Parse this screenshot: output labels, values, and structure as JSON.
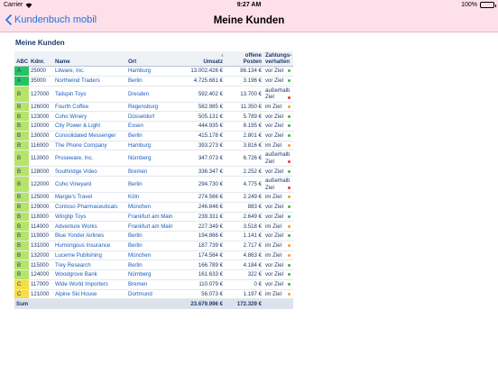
{
  "status_bar": {
    "carrier": "Carrier",
    "time": "9:27 AM",
    "battery": "100%",
    "battery_level": 1.0
  },
  "nav": {
    "back_label": "Kundenbuch mobil",
    "title": "Meine Kunden"
  },
  "section_title": "Meine Kunden",
  "colors": {
    "A": "#22c55e",
    "B": "#b6e36a",
    "C": "#f5dd45",
    "green": "#4caf50",
    "red": "#e53935",
    "orange": "#f0a030"
  },
  "columns": {
    "abc": "ABC",
    "kdnr": "Kdnr.",
    "name": "Name",
    "ort": "Ort",
    "umsatz": "Umsatz",
    "posten": "offene Posten",
    "verhalten": "Zahlungs- verhalten"
  },
  "rows": [
    {
      "abc": "A",
      "kdnr": "25000",
      "name": "Litware, Inc.",
      "ort": "Hamburg",
      "umsatz": "13.002.426 €",
      "posten": "86.134 €",
      "verhalten": "vor Ziel",
      "dot": "green"
    },
    {
      "abc": "A",
      "kdnr": "35000",
      "name": "Northwind Traders",
      "ort": "Berlin",
      "umsatz": "4.725.681 €",
      "posten": "3.196 €",
      "verhalten": "vor Ziel",
      "dot": "green"
    },
    {
      "abc": "B",
      "kdnr": "127000",
      "name": "Tailspin Toys",
      "ort": "Dresden",
      "umsatz": "592.402 €",
      "posten": "13.700 €",
      "verhalten": "außerhalb Ziel",
      "dot": "red"
    },
    {
      "abc": "B",
      "kdnr": "126000",
      "name": "Fourth Coffee",
      "ort": "Regensburg",
      "umsatz": "582.985 €",
      "posten": "11.350 €",
      "verhalten": "im Ziel",
      "dot": "orange"
    },
    {
      "abc": "B",
      "kdnr": "123000",
      "name": "Coho Winery",
      "ort": "Düsseldorf",
      "umsatz": "505.131 €",
      "posten": "5.789 €",
      "verhalten": "vor Ziel",
      "dot": "green"
    },
    {
      "abc": "B",
      "kdnr": "120000",
      "name": "City Power & Light",
      "ort": "Essen",
      "umsatz": "444.935 €",
      "posten": "8.195 €",
      "verhalten": "vor Ziel",
      "dot": "green"
    },
    {
      "abc": "B",
      "kdnr": "130000",
      "name": "Consolidated Messenger",
      "ort": "Berlin",
      "umsatz": "415.178 €",
      "posten": "2.801 €",
      "verhalten": "vor Ziel",
      "dot": "green"
    },
    {
      "abc": "B",
      "kdnr": "116000",
      "name": "The Phone Company",
      "ort": "Hamburg",
      "umsatz": "393.273 €",
      "posten": "3.816 €",
      "verhalten": "im Ziel",
      "dot": "orange"
    },
    {
      "abc": "B",
      "kdnr": "113000",
      "name": "Proseware, Inc.",
      "ort": "Nürnberg",
      "umsatz": "347.073 €",
      "posten": "6.726 €",
      "verhalten": "außerhalb Ziel",
      "dot": "red"
    },
    {
      "abc": "B",
      "kdnr": "128000",
      "name": "Southridge Video",
      "ort": "Bremen",
      "umsatz": "336.347 €",
      "posten": "2.252 €",
      "verhalten": "vor Ziel",
      "dot": "green"
    },
    {
      "abc": "B",
      "kdnr": "122000",
      "name": "Coho Vineyard",
      "ort": "Berlin",
      "umsatz": "294.730 €",
      "posten": "4.775 €",
      "verhalten": "außerhalb Ziel",
      "dot": "red"
    },
    {
      "abc": "B",
      "kdnr": "125000",
      "name": "Margie's Travel",
      "ort": "Köln",
      "umsatz": "274.566 €",
      "posten": "2.249 €",
      "verhalten": "im Ziel",
      "dot": "orange"
    },
    {
      "abc": "B",
      "kdnr": "129000",
      "name": "Contoso Pharmaceuticals",
      "ort": "München",
      "umsatz": "246.846 €",
      "posten": "883 €",
      "verhalten": "vor Ziel",
      "dot": "green"
    },
    {
      "abc": "B",
      "kdnr": "118000",
      "name": "Wingtip Toys",
      "ort": "Frankfurt am Main",
      "umsatz": "239.331 €",
      "posten": "2.649 €",
      "verhalten": "vor Ziel",
      "dot": "green"
    },
    {
      "abc": "B",
      "kdnr": "114000",
      "name": "Adventure Works",
      "ort": "Frankfurt am Main",
      "umsatz": "227.349 €",
      "posten": "3.518 €",
      "verhalten": "im Ziel",
      "dot": "orange"
    },
    {
      "abc": "B",
      "kdnr": "119000",
      "name": "Blue Yonder Airlines",
      "ort": "Berlin",
      "umsatz": "194.866 €",
      "posten": "1.141 €",
      "verhalten": "vor Ziel",
      "dot": "green"
    },
    {
      "abc": "B",
      "kdnr": "131000",
      "name": "Humongous Insurance",
      "ort": "Berlin",
      "umsatz": "187.739 €",
      "posten": "2.717 €",
      "verhalten": "im Ziel",
      "dot": "orange"
    },
    {
      "abc": "B",
      "kdnr": "132000",
      "name": "Lucerne Publishing",
      "ort": "München",
      "umsatz": "174.564 €",
      "posten": "4.863 €",
      "verhalten": "im Ziel",
      "dot": "orange"
    },
    {
      "abc": "B",
      "kdnr": "115000",
      "name": "Trey Research",
      "ort": "Berlin",
      "umsatz": "166.789 €",
      "posten": "4.184 €",
      "verhalten": "vor Ziel",
      "dot": "green"
    },
    {
      "abc": "B",
      "kdnr": "124000",
      "name": "Woodgrove Bank",
      "ort": "Nürnberg",
      "umsatz": "161.633 €",
      "posten": "322 €",
      "verhalten": "vor Ziel",
      "dot": "green"
    },
    {
      "abc": "C",
      "kdnr": "117000",
      "name": "Wide World Importers",
      "ort": "Bremen",
      "umsatz": "110.079 €",
      "posten": "0 €",
      "verhalten": "vor Ziel",
      "dot": "green"
    },
    {
      "abc": "C",
      "kdnr": "121000",
      "name": "Alpine Ski House",
      "ort": "Dortmund",
      "umsatz": "56.073 €",
      "posten": "1.197 €",
      "verhalten": "im Ziel",
      "dot": "orange"
    }
  ],
  "footer": {
    "label": "Sum",
    "umsatz": "23.679.996 €",
    "posten": "172.329 €"
  }
}
